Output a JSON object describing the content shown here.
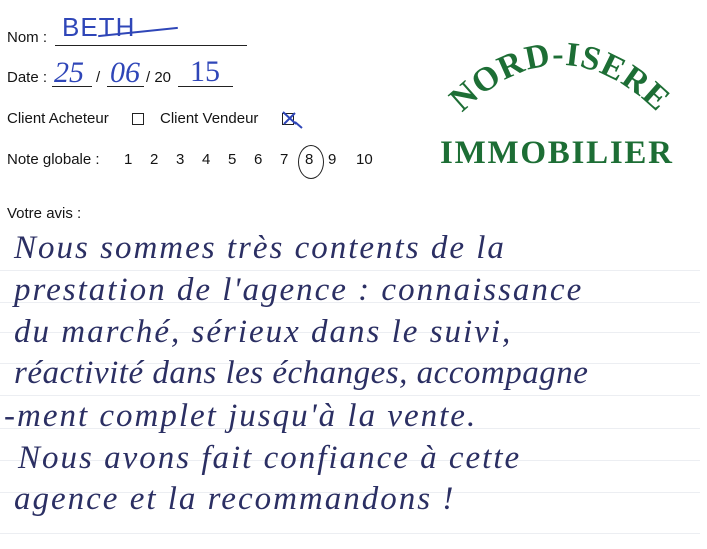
{
  "form": {
    "name_label": "Nom :",
    "name_value": "Beth",
    "date_label": "Date :",
    "date_day": "25",
    "date_month": "06",
    "date_sep": "/",
    "date_century": "/ 20",
    "date_year": "15",
    "buyer_label": "Client Acheteur",
    "buyer_checked": false,
    "seller_label": "Client Vendeur",
    "seller_checked": true,
    "rating_label": "Note globale :",
    "rating_options": [
      "1",
      "2",
      "3",
      "4",
      "5",
      "6",
      "7",
      "8",
      "9",
      "10"
    ],
    "rating_selected": 8,
    "review_label": "Votre avis :"
  },
  "logo": {
    "line1": "NORD-ISERE",
    "line2": "IMMOBILIER",
    "color": "#1d6e35"
  },
  "review_lines": [
    "Nous sommes très contents de la",
    "prestation de l'agence : connaissance",
    "du marché, sérieux dans le suivi,",
    "réactivité dans les échanges, accompagne",
    "-ment complet jusqu'à la vente.",
    "Nous avons fait confiance à cette",
    "agence et la recommandons !"
  ]
}
